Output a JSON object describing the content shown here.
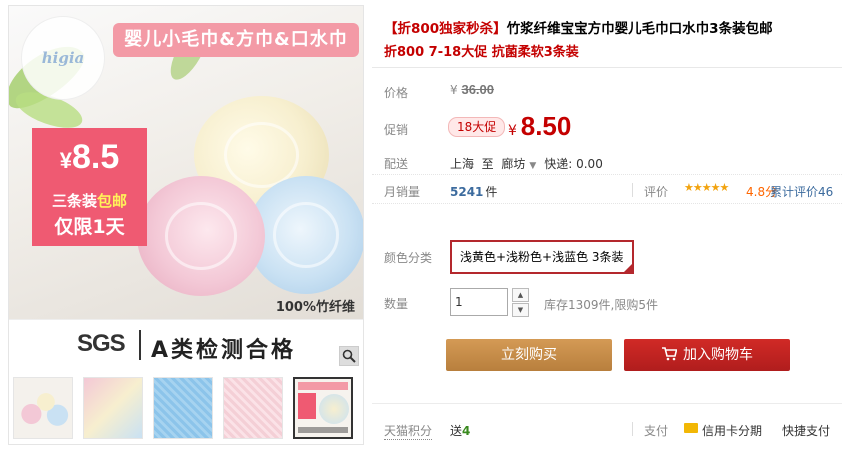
{
  "gallery": {
    "logo": "higia",
    "banner": "婴儿小毛巾&方巾&口水巾",
    "badge_currency": "¥",
    "badge_price": "8.5",
    "badge_line1_a": "三条装",
    "badge_line1_b": "包邮",
    "badge_line2": "仅限1天",
    "fiber": "100%竹纤维",
    "sgs_logo": "SGS",
    "sgs_text": "A类检测合格",
    "thumb5_text": "SGS A类检测合格"
  },
  "product": {
    "title_tag": "【折800独家秒杀】",
    "title_rest": "竹浆纤维宝宝方巾婴儿毛巾口水巾3条装包邮",
    "subtitle": "折800 7-18大促 抗菌柔软3条装"
  },
  "price": {
    "label": "价格",
    "currency": "¥",
    "original": "36.00"
  },
  "promo": {
    "label": "促销",
    "tag": "18大促",
    "currency": "¥",
    "price": "8.50"
  },
  "shipping": {
    "label": "配送",
    "from": "上海",
    "to_word": "至",
    "to": "廊坊",
    "fee": "快递: 0.00"
  },
  "sales": {
    "label": "月销量",
    "count": "5241",
    "unit": "件",
    "rating_label": "评价",
    "stars": "★★★★★",
    "score": "4.8分",
    "reviews": "累计评价46"
  },
  "sku": {
    "color_label": "颜色分类",
    "color_option": "浅黄色+浅粉色+浅蓝色 3条装",
    "qty_label": "数量",
    "qty_value": "1",
    "stock": "库存1309件,限购5件"
  },
  "buttons": {
    "buy": "立刻购买",
    "cart": "加入购物车"
  },
  "bottom": {
    "points_label": "天猫积分",
    "points_prefix": "送",
    "points_value": "4",
    "pay_label": "支付",
    "card": "信用卡分期",
    "fast": "快捷支付"
  },
  "colors": {
    "accent_red": "#c40000",
    "buy_button": "#c58e4a",
    "cart_button": "#c4221f",
    "link_blue": "#3c6b9e"
  }
}
